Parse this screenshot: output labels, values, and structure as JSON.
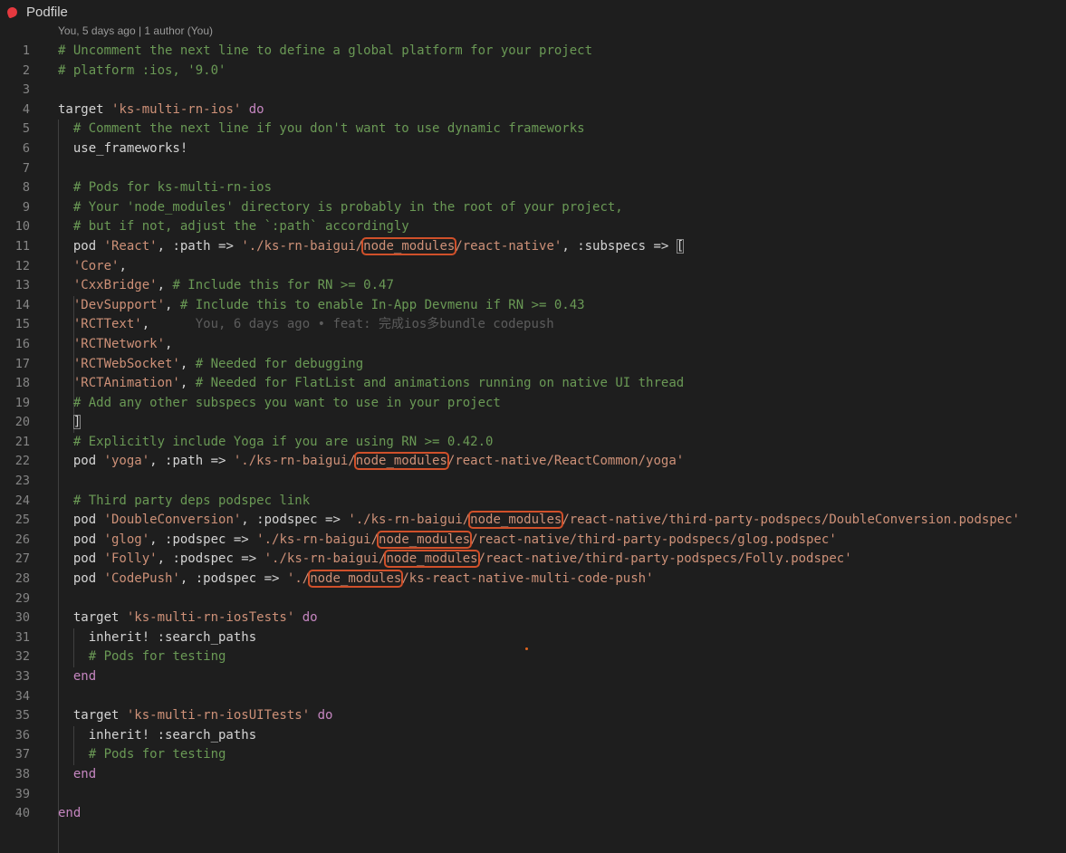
{
  "tab": {
    "filename": "Podfile",
    "icon": "ruby-icon",
    "icon_color": "#e5393f"
  },
  "codelens": "You, 5 days ago | 1 author (You)",
  "colors": {
    "comment": "#6a9955",
    "string": "#ce9178",
    "keyword": "#c586c0",
    "text": "#d4d4d4",
    "highlight_box": "#d0502a"
  },
  "lines": [
    {
      "n": "1",
      "tokens": [
        {
          "t": "# Uncomment the next line to define a global platform for your project",
          "c": "comment"
        }
      ]
    },
    {
      "n": "2",
      "tokens": [
        {
          "t": "# platform :ios, '9.0'",
          "c": "comment"
        }
      ]
    },
    {
      "n": "3",
      "tokens": []
    },
    {
      "n": "4",
      "tokens": [
        {
          "t": "target ",
          "c": "text"
        },
        {
          "t": "'ks-multi-rn-ios'",
          "c": "string"
        },
        {
          "t": " ",
          "c": "text"
        },
        {
          "t": "do",
          "c": "keyword"
        }
      ]
    },
    {
      "n": "5",
      "tokens": [
        {
          "t": "  # Comment the next line if you don't want to use dynamic frameworks",
          "c": "comment"
        }
      ]
    },
    {
      "n": "6",
      "tokens": [
        {
          "t": "  use_frameworks!",
          "c": "text"
        }
      ]
    },
    {
      "n": "7",
      "tokens": []
    },
    {
      "n": "8",
      "tokens": [
        {
          "t": "  # Pods for ks-multi-rn-ios",
          "c": "comment"
        }
      ]
    },
    {
      "n": "9",
      "tokens": [
        {
          "t": "  # Your 'node_modules' directory is probably in the root of your project,",
          "c": "comment"
        }
      ]
    },
    {
      "n": "10",
      "tokens": [
        {
          "t": "  # but if not, adjust the `:path` accordingly",
          "c": "comment"
        }
      ]
    },
    {
      "n": "11",
      "tokens": [
        {
          "t": "  pod ",
          "c": "text"
        },
        {
          "t": "'React'",
          "c": "string"
        },
        {
          "t": ", :path => ",
          "c": "text"
        },
        {
          "t": "'./ks-rn-baigui/",
          "c": "string"
        },
        {
          "t": "node_modules",
          "c": "hl"
        },
        {
          "t": "/react-native'",
          "c": "string"
        },
        {
          "t": ", :subspecs => ",
          "c": "text"
        },
        {
          "t": "[",
          "c": "bracket"
        }
      ]
    },
    {
      "n": "12",
      "tokens": [
        {
          "t": "  ",
          "c": "text"
        },
        {
          "t": "'Core'",
          "c": "string"
        },
        {
          "t": ",",
          "c": "text"
        }
      ]
    },
    {
      "n": "13",
      "tokens": [
        {
          "t": "  ",
          "c": "text"
        },
        {
          "t": "'CxxBridge'",
          "c": "string"
        },
        {
          "t": ", ",
          "c": "text"
        },
        {
          "t": "# Include this for RN >= 0.47",
          "c": "comment"
        }
      ]
    },
    {
      "n": "14",
      "tokens": [
        {
          "t": "  ",
          "c": "text"
        },
        {
          "t": "'DevSupport'",
          "c": "string"
        },
        {
          "t": ", ",
          "c": "text"
        },
        {
          "t": "# Include this to enable In-App Devmenu if RN >= 0.43",
          "c": "comment"
        }
      ]
    },
    {
      "n": "15",
      "tokens": [
        {
          "t": "  ",
          "c": "text"
        },
        {
          "t": "'RCTText'",
          "c": "string"
        },
        {
          "t": ",",
          "c": "text"
        },
        {
          "t": "      You, 6 days ago • feat: 完成ios多bundle codepush",
          "c": "blame"
        }
      ]
    },
    {
      "n": "16",
      "tokens": [
        {
          "t": "  ",
          "c": "text"
        },
        {
          "t": "'RCTNetwork'",
          "c": "string"
        },
        {
          "t": ",",
          "c": "text"
        }
      ]
    },
    {
      "n": "17",
      "tokens": [
        {
          "t": "  ",
          "c": "text"
        },
        {
          "t": "'RCTWebSocket'",
          "c": "string"
        },
        {
          "t": ", ",
          "c": "text"
        },
        {
          "t": "# Needed for debugging",
          "c": "comment"
        }
      ]
    },
    {
      "n": "18",
      "tokens": [
        {
          "t": "  ",
          "c": "text"
        },
        {
          "t": "'RCTAnimation'",
          "c": "string"
        },
        {
          "t": ", ",
          "c": "text"
        },
        {
          "t": "# Needed for FlatList and animations running on native UI thread",
          "c": "comment"
        }
      ]
    },
    {
      "n": "19",
      "tokens": [
        {
          "t": "  # Add any other subspecs you want to use in your project",
          "c": "comment"
        }
      ]
    },
    {
      "n": "20",
      "tokens": [
        {
          "t": "  ",
          "c": "text"
        },
        {
          "t": "]",
          "c": "bracket"
        }
      ]
    },
    {
      "n": "21",
      "tokens": [
        {
          "t": "  # Explicitly include Yoga if you are using RN >= 0.42.0",
          "c": "comment"
        }
      ]
    },
    {
      "n": "22",
      "tokens": [
        {
          "t": "  pod ",
          "c": "text"
        },
        {
          "t": "'yoga'",
          "c": "string"
        },
        {
          "t": ", :path => ",
          "c": "text"
        },
        {
          "t": "'./ks-rn-baigui/",
          "c": "string"
        },
        {
          "t": "node_modules",
          "c": "hl"
        },
        {
          "t": "/react-native/ReactCommon/yoga'",
          "c": "string"
        }
      ]
    },
    {
      "n": "23",
      "tokens": []
    },
    {
      "n": "24",
      "tokens": [
        {
          "t": "  # Third party deps podspec link",
          "c": "comment"
        }
      ]
    },
    {
      "n": "25",
      "tokens": [
        {
          "t": "  pod ",
          "c": "text"
        },
        {
          "t": "'DoubleConversion'",
          "c": "string"
        },
        {
          "t": ", :podspec => ",
          "c": "text"
        },
        {
          "t": "'./ks-rn-baigui/",
          "c": "string"
        },
        {
          "t": "node_modules",
          "c": "hl"
        },
        {
          "t": "/react-native/third-party-podspecs/DoubleConversion.podspec'",
          "c": "string"
        }
      ]
    },
    {
      "n": "26",
      "tokens": [
        {
          "t": "  pod ",
          "c": "text"
        },
        {
          "t": "'glog'",
          "c": "string"
        },
        {
          "t": ", :podspec => ",
          "c": "text"
        },
        {
          "t": "'./ks-rn-baigui/",
          "c": "string"
        },
        {
          "t": "node_modules",
          "c": "hl"
        },
        {
          "t": "/react-native/third-party-podspecs/glog.podspec'",
          "c": "string"
        }
      ]
    },
    {
      "n": "27",
      "tokens": [
        {
          "t": "  pod ",
          "c": "text"
        },
        {
          "t": "'Folly'",
          "c": "string"
        },
        {
          "t": ", :podspec => ",
          "c": "text"
        },
        {
          "t": "'./ks-rn-baigui/",
          "c": "string"
        },
        {
          "t": "node_modules",
          "c": "hl"
        },
        {
          "t": "/react-native/third-party-podspecs/Folly.podspec'",
          "c": "string"
        }
      ]
    },
    {
      "n": "28",
      "tokens": [
        {
          "t": "  pod ",
          "c": "text"
        },
        {
          "t": "'CodePush'",
          "c": "string"
        },
        {
          "t": ", :podspec => ",
          "c": "text"
        },
        {
          "t": "'./",
          "c": "string"
        },
        {
          "t": "node_modules",
          "c": "hl"
        },
        {
          "t": "/ks-react-native-multi-code-push'",
          "c": "string"
        }
      ]
    },
    {
      "n": "29",
      "tokens": []
    },
    {
      "n": "30",
      "tokens": [
        {
          "t": "  target ",
          "c": "text"
        },
        {
          "t": "'ks-multi-rn-iosTests'",
          "c": "string"
        },
        {
          "t": " ",
          "c": "text"
        },
        {
          "t": "do",
          "c": "keyword"
        }
      ]
    },
    {
      "n": "31",
      "tokens": [
        {
          "t": "    inherit! :search_paths",
          "c": "text"
        }
      ]
    },
    {
      "n": "32",
      "tokens": [
        {
          "t": "    # Pods for testing",
          "c": "comment"
        }
      ]
    },
    {
      "n": "33",
      "tokens": [
        {
          "t": "  ",
          "c": "text"
        },
        {
          "t": "end",
          "c": "keyword"
        }
      ]
    },
    {
      "n": "34",
      "tokens": []
    },
    {
      "n": "35",
      "tokens": [
        {
          "t": "  target ",
          "c": "text"
        },
        {
          "t": "'ks-multi-rn-iosUITests'",
          "c": "string"
        },
        {
          "t": " ",
          "c": "text"
        },
        {
          "t": "do",
          "c": "keyword"
        }
      ]
    },
    {
      "n": "36",
      "tokens": [
        {
          "t": "    inherit! :search_paths",
          "c": "text"
        }
      ]
    },
    {
      "n": "37",
      "tokens": [
        {
          "t": "    # Pods for testing",
          "c": "comment"
        }
      ]
    },
    {
      "n": "38",
      "tokens": [
        {
          "t": "  ",
          "c": "text"
        },
        {
          "t": "end",
          "c": "keyword"
        }
      ]
    },
    {
      "n": "39",
      "tokens": []
    },
    {
      "n": "40",
      "tokens": [
        {
          "t": "end",
          "c": "keyword"
        }
      ]
    }
  ]
}
